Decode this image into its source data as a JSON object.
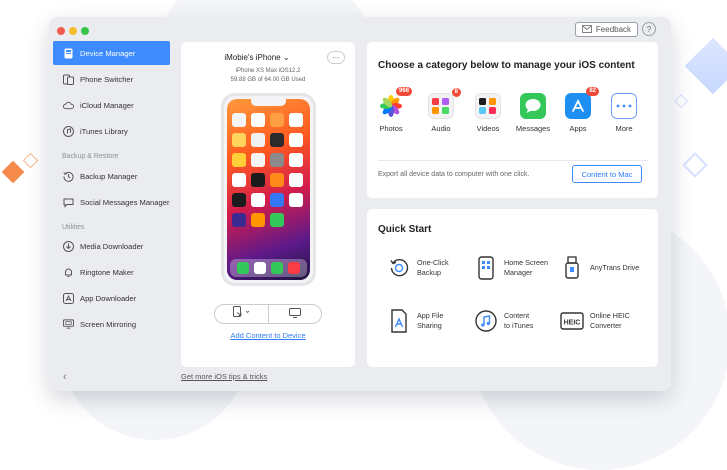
{
  "window": {
    "feedback_label": "Feedback",
    "help_label": "?",
    "traffic_colors": [
      "#f25b4e",
      "#f5bd2a",
      "#36c548"
    ]
  },
  "sidebar": {
    "items": [
      {
        "label": "Device Manager",
        "icon": "device-manager-icon",
        "active": true
      },
      {
        "label": "Phone Switcher",
        "icon": "phone-switcher-icon"
      },
      {
        "label": "iCloud Manager",
        "icon": "cloud-icon"
      },
      {
        "label": "iTunes Library",
        "icon": "music-note-icon"
      }
    ],
    "sections": [
      {
        "title": "Backup & Restore",
        "items": [
          {
            "label": "Backup Manager",
            "icon": "backup-clock-icon"
          },
          {
            "label": "Social Messages Manager",
            "icon": "chat-bubble-icon"
          }
        ]
      },
      {
        "title": "Utilities",
        "items": [
          {
            "label": "Media Downloader",
            "icon": "download-icon"
          },
          {
            "label": "Ringtone Maker",
            "icon": "bell-icon"
          },
          {
            "label": "App Downloader",
            "icon": "app-store-icon"
          },
          {
            "label": "Screen Mirroring",
            "icon": "screen-mirroring-icon"
          }
        ]
      }
    ],
    "collapse_label": "‹",
    "tips_link": "Get more iOS tips & tricks"
  },
  "device": {
    "name": "iMobie's iPhone",
    "name_chevron": "⌄",
    "more_label": "···",
    "model": "iPhone XS Max iOS12.2",
    "storage": "59.88 GB of 64.00 GB Used",
    "add_content_label": "Add Content to Device"
  },
  "categories": {
    "title": "Choose a category below to manage your iOS content",
    "items": [
      {
        "label": "Photos",
        "badge": "968",
        "icon": "photos-icon",
        "color": "#ffffff"
      },
      {
        "label": "Audio",
        "badge": "8",
        "icon": "audio-icon",
        "color": "#ffffff"
      },
      {
        "label": "Videos",
        "badge": "",
        "icon": "videos-icon",
        "color": "#ffffff"
      },
      {
        "label": "Messages",
        "badge": "",
        "icon": "messages-icon",
        "color": "#34c759"
      },
      {
        "label": "Apps",
        "badge": "82",
        "icon": "apps-icon",
        "color": "#1e8ff2"
      },
      {
        "label": "More",
        "badge": "",
        "icon": "more-icon",
        "color": "#ffffff"
      }
    ],
    "export_text": "Export all device data to computer with one click.",
    "content_to_mac_label": "Content to Mac"
  },
  "quick_start": {
    "title": "Quick Start",
    "items": [
      {
        "label": "One-Click\nBackup",
        "icon": "one-click-backup-icon"
      },
      {
        "label": "Home Screen\nManager",
        "icon": "home-screen-manager-icon"
      },
      {
        "label": "AnyTrans Drive",
        "icon": "usb-drive-icon"
      },
      {
        "label": "App File\nSharing",
        "icon": "app-file-sharing-icon"
      },
      {
        "label": "Content\nto iTunes",
        "icon": "itunes-icon"
      },
      {
        "label": "Online HEIC\nConverter",
        "icon": "heic-icon"
      }
    ]
  },
  "colors": {
    "accent": "#3d8bfd",
    "link": "#2e7cf6",
    "badge": "#f04a38",
    "decor_orange": "#f58a4b",
    "decor_blue": "#c6d8ff"
  }
}
